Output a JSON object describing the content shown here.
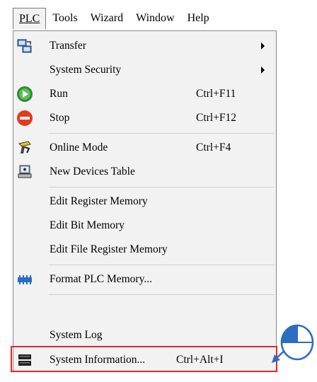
{
  "menubar": {
    "plc": "PLC",
    "tools": "Tools",
    "wizard": "Wizard",
    "window": "Window",
    "help": "Help"
  },
  "menu": {
    "transfer": "Transfer",
    "system_security": "System Security",
    "run": "Run",
    "run_shortcut": "Ctrl+F11",
    "stop": "Stop",
    "stop_shortcut": "Ctrl+F12",
    "online_mode": "Online Mode",
    "online_mode_shortcut": "Ctrl+F4",
    "new_devices_table": "New Devices Table",
    "edit_register_memory": "Edit Register Memory",
    "edit_bit_memory": "Edit Bit Memory",
    "edit_file_register_memory": "Edit File Register Memory",
    "format_plc_memory": "Format PLC Memory...",
    "system_log": "System Log",
    "system_information": "System Information...",
    "system_information_shortcut": "Ctrl+Alt+I"
  },
  "icons": {
    "transfer": "transfer-icon",
    "run": "run-icon",
    "stop": "stop-icon",
    "online_mode": "online-mode-icon",
    "new_devices_table": "devices-icon",
    "format_plc_memory": "memory-chip-icon",
    "system_information": "info-icon",
    "pointer": "mouse-click-icon"
  },
  "colors": {
    "highlight": "#e8262d",
    "pointer": "#2b6cc4",
    "run": "#2e8b2e",
    "stop": "#e23b1e"
  }
}
